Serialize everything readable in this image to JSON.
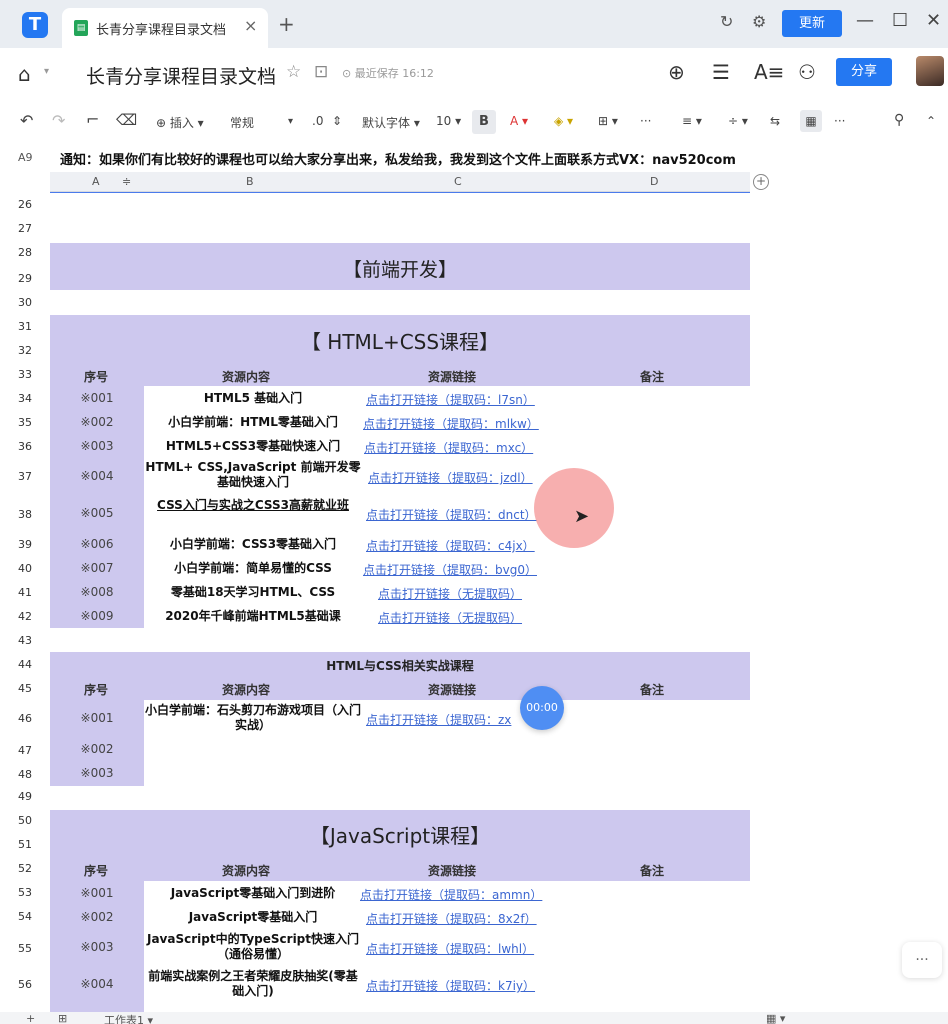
{
  "titlebar": {
    "tab_title": "长青分享课程目录文档",
    "tab_close": "×",
    "new_tab": "+",
    "update_label": "更新",
    "minimize": "—",
    "maximize": "☐",
    "close": "✕",
    "app_logo": "T",
    "file_icon": "▤"
  },
  "doc": {
    "home": "⌂",
    "caret": "▾",
    "title": "长青分享课程目录文档",
    "star": "☆",
    "move": "⊡",
    "saved_text": "⊙ 最近保存 16:12",
    "share_label": "分享",
    "add_icon": "⊕",
    "list_icon": "☰",
    "format_icon": "A≡",
    "user_icon": "⚇"
  },
  "toolbar": {
    "undo": "↶",
    "redo": "↷",
    "paint": "⌐",
    "clear": "⌫",
    "insert": "⊕ 插入 ▾",
    "format": "常规",
    "format_caret": "▾",
    "decimal": ".0",
    "decimal_arrows": "⇕",
    "font": "默认字体 ▾",
    "size": "10 ▾",
    "bold": "B",
    "fontcolor": "A ▾",
    "fill": "◈ ▾",
    "border": "⊞ ▾",
    "more1": "···",
    "align": "≡ ▾",
    "valign": "÷ ▾",
    "wrap": "⇆",
    "merge": "▦",
    "more2": "···",
    "search": "⚲",
    "collapse": "⌃"
  },
  "formula_bar": {
    "cell_ref": "A9",
    "content": "通知：如果你们有比较好的课程也可以给大家分享出来，私发给我，我发到这个文件上面联系方式VX：nav520com"
  },
  "columns": [
    "A",
    "B",
    "C",
    "D"
  ],
  "rows": [
    "26",
    "27",
    "28",
    "29",
    "30",
    "31",
    "32",
    "33",
    "34",
    "35",
    "36",
    "37",
    "38",
    "39",
    "40",
    "41",
    "42",
    "43",
    "44",
    "45",
    "46",
    "47",
    "48",
    "49",
    "50",
    "51",
    "52",
    "53",
    "54",
    "55",
    "56"
  ],
  "headers": {
    "seq": "序号",
    "content": "资源内容",
    "link": "资源链接",
    "note": "备注"
  },
  "sections": {
    "frontend": "【前端开发】",
    "html_css": "【 HTML+CSS课程】",
    "practice": "HTML与CSS相关实战课程",
    "js": "【JavaScript课程】"
  },
  "html_css_courses": [
    {
      "seq": "※001",
      "title": "HTML5 基础入门",
      "link": "点击打开链接（提取码：l7sn）"
    },
    {
      "seq": "※002",
      "title": "小白学前端：HTML零基础入门",
      "link": "点击打开链接（提取码：mlkw）"
    },
    {
      "seq": "※003",
      "title": "HTML5+CSS3零基础快速入门",
      "link": "点击打开链接（提取码：mxc）"
    },
    {
      "seq": "※004",
      "title": "HTML+ CSS,JavaScript 前端开发零基础快速入门",
      "link": "点击打开链接（提取码：jzdl）"
    },
    {
      "seq": "※005",
      "title": "CSS入门与实战之CSS3高薪就业班",
      "link": "点击打开链接（提取码：dnct）"
    },
    {
      "seq": "※006",
      "title": "小白学前端：CSS3零基础入门",
      "link": "点击打开链接（提取码：c4jx）"
    },
    {
      "seq": "※007",
      "title": "小白学前端：简单易懂的CSS",
      "link": "点击打开链接（提取码：bvg0）"
    },
    {
      "seq": "※008",
      "title": "零基础18天学习HTML、CSS",
      "link": "点击打开链接（无提取码）"
    },
    {
      "seq": "※009",
      "title": "2020年千峰前端HTML5基础课",
      "link": "点击打开链接（无提取码）"
    }
  ],
  "practice_courses": [
    {
      "seq": "※001",
      "title": "小白学前端：石头剪刀布游戏项目（入门实战）",
      "link": "点击打开链接（提取码：zx"
    },
    {
      "seq": "※002",
      "title": "",
      "link": ""
    },
    {
      "seq": "※003",
      "title": "",
      "link": ""
    }
  ],
  "js_courses": [
    {
      "seq": "※001",
      "title": "JavaScript零基础入门到进阶",
      "link": "点击打开链接（提取码：ammn）"
    },
    {
      "seq": "※002",
      "title": "JavaScript零基础入门",
      "link": "点击打开链接（提取码：8x2f）"
    },
    {
      "seq": "※003",
      "title": "JavaScript中的TypeScript快速入门（通俗易懂）",
      "link": "点击打开链接（提取码：lwhl）"
    },
    {
      "seq": "※004",
      "title": "前端实战案例之王者荣耀皮肤抽奖(零基础入门)",
      "link": "点击打开链接（提取码：k7iy）"
    }
  ],
  "overlay": {
    "timer": "00:00",
    "more": "···",
    "pointer": "➤"
  },
  "bottom": {
    "add_sheet": "+",
    "sheet_list": "⊞",
    "sheet_name": "工作表1 ▾",
    "view": "▦ ▾"
  }
}
